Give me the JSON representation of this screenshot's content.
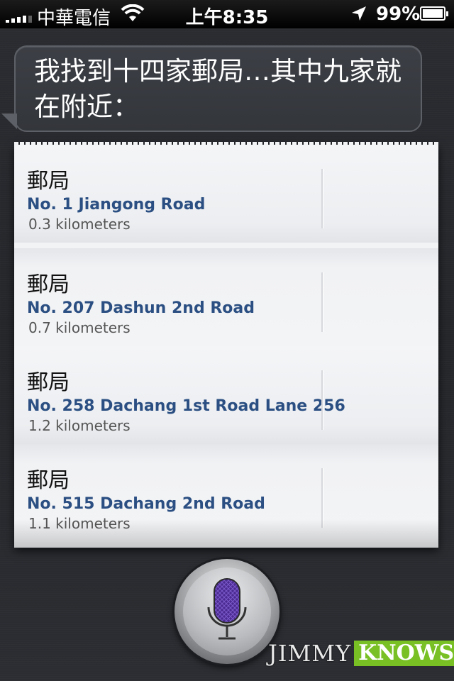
{
  "status_bar": {
    "carrier": "中華電信",
    "time": "上午8:35",
    "battery": "99%",
    "icons": [
      "signal-icon",
      "wifi-icon",
      "location-arrow-icon",
      "battery-charging-icon"
    ]
  },
  "siri_response": {
    "text": "我找到十四家郵局…其中九家就在附近："
  },
  "results": [
    {
      "name": "郵局",
      "address": "No. 1 Jiangong Road",
      "distance": "0.3 kilometers"
    },
    {
      "name": "郵局",
      "address": "No. 207 Dashun 2nd Road",
      "distance": "0.7 kilometers"
    },
    {
      "name": "郵局",
      "address": "No. 258 Dachang 1st Road Lane 256",
      "distance": "1.2 kilometers"
    },
    {
      "name": "郵局",
      "address": "No. 515 Dachang 2nd Road",
      "distance": "1.1 kilometers"
    }
  ],
  "mic_button": {
    "icon": "microphone-icon"
  },
  "watermark": {
    "part1": "JIMMY",
    "part2": "KNOWS"
  },
  "colors": {
    "address": "#2b4f82",
    "watermark_accent": "#78c024",
    "mic_purple": "#4b2b91"
  }
}
